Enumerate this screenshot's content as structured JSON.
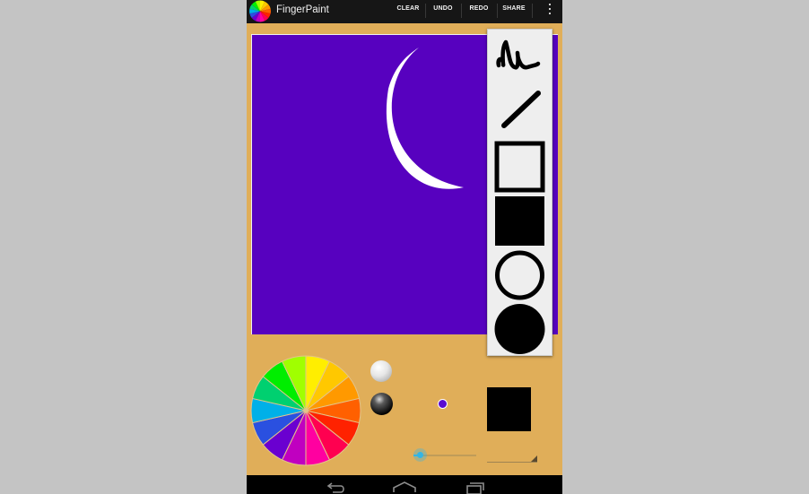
{
  "app": {
    "title": "FingerPaint",
    "icon": "color-wheel-app-icon"
  },
  "actionbar": {
    "clear_label": "CLEAR",
    "undo_label": "UNDO",
    "redo_label": "REDO",
    "share_label": "SHARE",
    "overflow_icon": "overflow-menu-icon"
  },
  "canvas": {
    "background_color": "#5701bf",
    "drawing": "crescent-moon",
    "drawing_color": "#ffffff"
  },
  "tools": [
    {
      "name": "freehand",
      "icon": "freehand-squiggle-icon"
    },
    {
      "name": "line",
      "icon": "line-icon"
    },
    {
      "name": "rectangle-outline",
      "icon": "square-outline-icon"
    },
    {
      "name": "rectangle-filled",
      "icon": "square-filled-icon"
    },
    {
      "name": "circle-outline",
      "icon": "circle-outline-icon"
    },
    {
      "name": "circle-filled",
      "icon": "circle-filled-icon"
    }
  ],
  "color_wheel": {
    "colors": [
      "#ffee00",
      "#ffc800",
      "#ff9900",
      "#ff6000",
      "#ff2200",
      "#ff0050",
      "#ff00a0",
      "#c000c0",
      "#6a00d0",
      "#2a50e0",
      "#00b0e8",
      "#00d070",
      "#00ee00",
      "#a0ff00"
    ]
  },
  "brightness": {
    "light_orb": "white-orb-icon",
    "dark_orb": "black-orb-icon"
  },
  "current_color": "#5a0bd0",
  "stroke_swatch_color": "#000000",
  "brush_size": {
    "fraction": 0.1
  },
  "accent": "#33b5e5",
  "navigation": {
    "back": "back-icon",
    "home": "home-icon",
    "recents": "recents-icon"
  }
}
